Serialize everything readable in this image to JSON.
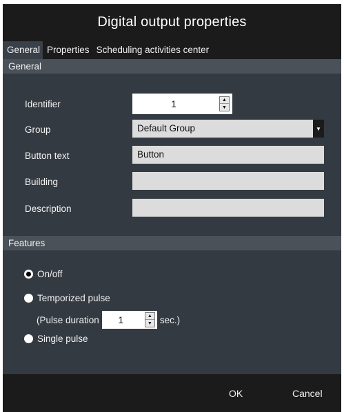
{
  "window": {
    "title": "Digital output properties"
  },
  "tabs": [
    {
      "label": "General"
    },
    {
      "label": "Properties"
    },
    {
      "label": "Scheduling activities center"
    }
  ],
  "general_section": {
    "header": "General",
    "identifier": {
      "label": "Identifier",
      "value": "1"
    },
    "group": {
      "label": "Group",
      "value": "Default Group"
    },
    "button_text": {
      "label": "Button text",
      "value": "Button"
    },
    "building": {
      "label": "Building",
      "value": ""
    },
    "description": {
      "label": "Description",
      "value": ""
    }
  },
  "features_section": {
    "header": "Features",
    "options": [
      {
        "label": "On/off",
        "selected": true
      },
      {
        "label": "Temporized pulse",
        "selected": false
      },
      {
        "label": "Single pulse",
        "selected": false
      }
    ],
    "pulse_duration": {
      "prefix": "(Pulse duration",
      "value": "1",
      "suffix": "sec.)"
    }
  },
  "footer": {
    "ok_label": "OK",
    "cancel_label": "Cancel"
  },
  "colors": {
    "titlebar_bg": "#1b1b1b",
    "body_bg": "#343a41",
    "section_header_bg": "#4b5158",
    "field_bg": "#dcdcdc"
  }
}
